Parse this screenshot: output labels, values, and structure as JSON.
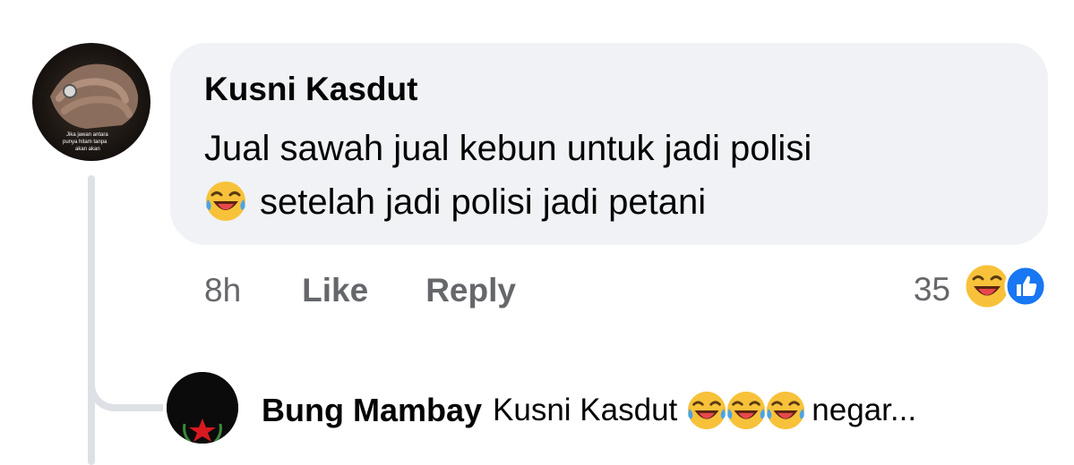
{
  "comment": {
    "author": "Kusni Kasdut",
    "text_line1": "Jual sawah jual kebun untuk jadi polisi",
    "text_line2": "setelah jadi polisi jadi petani",
    "time": "8h",
    "like_label": "Like",
    "reply_label": "Reply",
    "reaction_count": "35",
    "reaction_icons": [
      "laughing-emoji-icon",
      "like-icon"
    ],
    "avatar_overlay_text": "Jika jawan antara ... punya hitam tanpa ... akan akan"
  },
  "reply": {
    "author": "Bung Mambay",
    "mention": "Kusni Kasdut",
    "emoji_count": 3,
    "text_suffix": "negar..."
  },
  "colors": {
    "bubble_bg": "#f0f2f5",
    "secondary_text": "#65676b",
    "thread_line": "#dde1e6",
    "like_blue": "#1877f2",
    "emoji_yellow": "#f7c23a"
  }
}
